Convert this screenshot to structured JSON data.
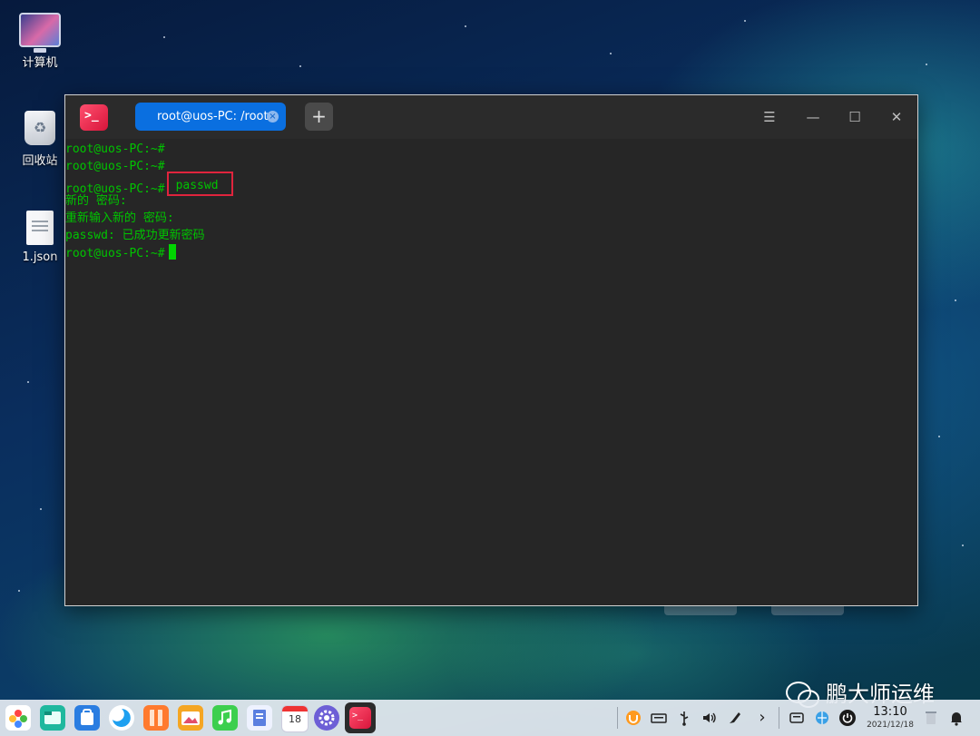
{
  "desktop": {
    "icons": [
      {
        "label": "计算机"
      },
      {
        "label": "回收站"
      },
      {
        "label": "1.json"
      }
    ]
  },
  "terminal": {
    "app_icon_text": ">_",
    "tab": {
      "title": "root@uos-PC: /root",
      "close_glyph": "×"
    },
    "add_tab_glyph": "+",
    "window_buttons": {
      "menu": "☰",
      "minimize": "—",
      "maximize": "☐",
      "close": "✕"
    },
    "lines": [
      "root@uos-PC:~#",
      "root@uos-PC:~#",
      "root@uos-PC:~#",
      "新的 密码:",
      "重新输入新的 密码:",
      "passwd: 已成功更新密码",
      "root@uos-PC:~#"
    ],
    "highlighted_command": "passwd",
    "cursor_color": "#00d400",
    "text_color": "#00c400",
    "highlight_color": "#e0243d"
  },
  "watermark": {
    "text": "鹏大师运维"
  },
  "dock": {
    "apps": [
      {
        "name": "launcher-icon",
        "color": "#ffffff"
      },
      {
        "name": "file-manager-icon",
        "color": "#1fb89e"
      },
      {
        "name": "app-store-icon",
        "color": "#2a7de1"
      },
      {
        "name": "browser-icon",
        "color": "#1ea0f0"
      },
      {
        "name": "archive-manager-icon",
        "color": "#ff7a2e"
      },
      {
        "name": "image-viewer-icon",
        "color": "#f5a623"
      },
      {
        "name": "music-icon",
        "color": "#3ccf4e"
      },
      {
        "name": "document-viewer-icon",
        "color": "#5a7fe0"
      },
      {
        "name": "calendar-icon",
        "color": "#ffffff"
      },
      {
        "name": "settings-icon",
        "color": "#6d5fd6"
      },
      {
        "name": "terminal-icon",
        "color": "#e0243d"
      }
    ],
    "calendar_day": "18",
    "tray_glyphs": {
      "expand": "›"
    },
    "clock": {
      "time": "13:10",
      "date": "2021/12/18"
    }
  }
}
